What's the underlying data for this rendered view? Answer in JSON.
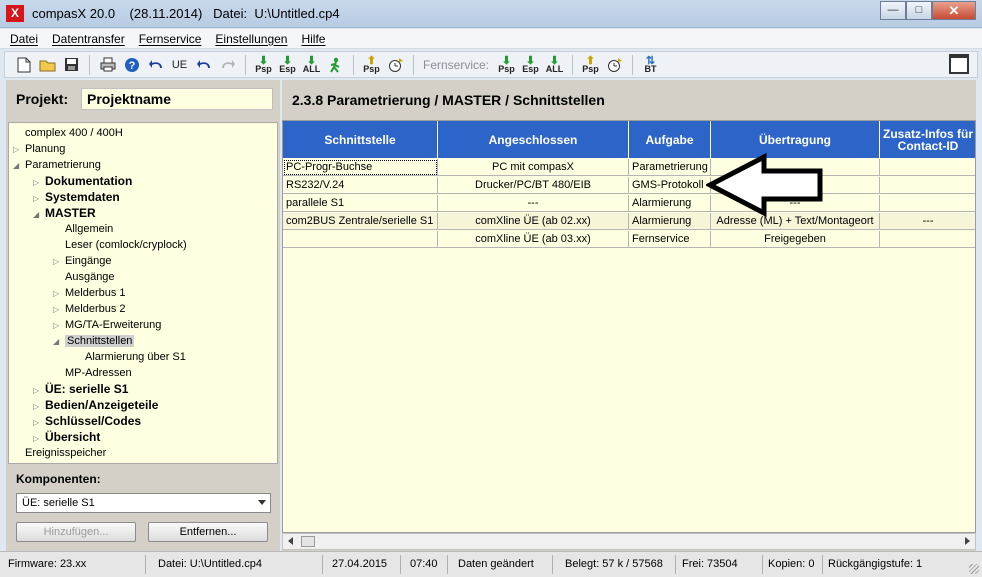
{
  "window": {
    "app_icon": "X",
    "title": "compasX 20.0    (28.11.2014)   Datei:  U:\\Untitled.cp4",
    "buttons": {
      "minimize": "—",
      "maximize": "□",
      "close": "✕"
    }
  },
  "menu": [
    "Datei",
    "Datentransfer",
    "Fernservice",
    "Einstellungen",
    "Hilfe"
  ],
  "toolbar": {
    "left_buttons": [
      "new-file",
      "open-folder",
      "save",
      "print",
      "help",
      "undo-ue",
      "UE",
      "undo",
      "redo"
    ],
    "transfer_buttons": [
      "Psp",
      "Esp",
      "ALL",
      "run"
    ],
    "psp_button": "Psp",
    "fernservice_label": "Fernservice:",
    "fernservice_buttons": [
      "Psp",
      "Esp",
      "ALL"
    ],
    "extra": [
      "Psp",
      "clock"
    ],
    "bt_label": "BT"
  },
  "left": {
    "project_label": "Projekt:",
    "project_value": "Projektname",
    "tree": [
      {
        "label": "complex 400 / 400H",
        "level": 0,
        "arrow": "",
        "bold": false
      },
      {
        "label": "Planung",
        "level": 0,
        "arrow": "▷",
        "bold": false
      },
      {
        "label": "Parametrierung",
        "level": 0,
        "arrow": "◢",
        "bold": false
      },
      {
        "label": "Dokumentation",
        "level": 1,
        "arrow": "▷",
        "bold": true
      },
      {
        "label": "Systemdaten",
        "level": 1,
        "arrow": "▷",
        "bold": true
      },
      {
        "label": "MASTER",
        "level": 1,
        "arrow": "◢",
        "bold": true
      },
      {
        "label": "Allgemein",
        "level": 2,
        "arrow": "",
        "bold": false
      },
      {
        "label": "Leser (comlock/cryplock)",
        "level": 2,
        "arrow": "",
        "bold": false
      },
      {
        "label": "Eingänge",
        "level": 2,
        "arrow": "▷",
        "bold": false
      },
      {
        "label": "Ausgänge",
        "level": 2,
        "arrow": "",
        "bold": false
      },
      {
        "label": "Melderbus 1",
        "level": 2,
        "arrow": "▷",
        "bold": false
      },
      {
        "label": "Melderbus 2",
        "level": 2,
        "arrow": "▷",
        "bold": false
      },
      {
        "label": "MG/TA-Erweiterung",
        "level": 2,
        "arrow": "▷",
        "bold": false
      },
      {
        "label": "Schnittstellen",
        "level": 2,
        "arrow": "◢",
        "bold": false,
        "selected": true
      },
      {
        "label": "Alarmierung über S1",
        "level": 3,
        "arrow": "",
        "bold": false
      },
      {
        "label": "MP-Adressen",
        "level": 2,
        "arrow": "",
        "bold": false
      },
      {
        "label": "ÜE: serielle S1",
        "level": 1,
        "arrow": "▷",
        "bold": true
      },
      {
        "label": "Bedien/Anzeigeteile",
        "level": 1,
        "arrow": "▷",
        "bold": true
      },
      {
        "label": "Schlüssel/Codes",
        "level": 1,
        "arrow": "▷",
        "bold": true
      },
      {
        "label": "Übersicht",
        "level": 1,
        "arrow": "▷",
        "bold": true
      },
      {
        "label": "Ereignisspeicher",
        "level": 0,
        "arrow": "",
        "bold": false
      }
    ],
    "components_label": "Komponenten:",
    "components_value": "ÜE: serielle S1",
    "add_button": "Hinzufügen...",
    "remove_button": "Entfernen..."
  },
  "main": {
    "section_title": "2.3.8  Parametrierung / MASTER / Schnittstellen",
    "columns": [
      "Schnittstelle",
      "Angeschlossen",
      "Aufgabe",
      "Übertragung",
      "Zusatz-Infos für Contact-ID"
    ],
    "rows": [
      [
        "PC-Progr-Buchse",
        "PC mit compasX",
        "Parametrierung",
        "",
        ""
      ],
      [
        "RS232/V.24",
        "Drucker/PC/BT 480/EIB",
        "GMS-Protokoll",
        "---",
        ""
      ],
      [
        "parallele S1",
        "---",
        "Alarmierung",
        "---",
        ""
      ],
      [
        "com2BUS Zentrale/serielle S1",
        "comXline ÜE (ab 02.xx)",
        "Alarmierung",
        "Adresse (ML) + Text/Montageort",
        "---"
      ],
      [
        "",
        "comXline ÜE (ab 03.xx)",
        "Fernservice",
        "Freigegeben",
        ""
      ]
    ]
  },
  "status": {
    "firmware": "Firmware: 23.xx",
    "file": "Datei: U:\\Untitled.cp4",
    "date": "27.04.2015",
    "time": "07:40",
    "changed": "Daten geändert",
    "used": "Belegt: 57 k / 57568",
    "free": "Frei: 73504",
    "copies": "Kopien: 0",
    "undo_level": "Rückgängigstufe: 1"
  },
  "colors": {
    "header_blue": "#2d64c8",
    "grid_bg": "#ffffe1",
    "panel_gray": "#d4d0c8"
  }
}
